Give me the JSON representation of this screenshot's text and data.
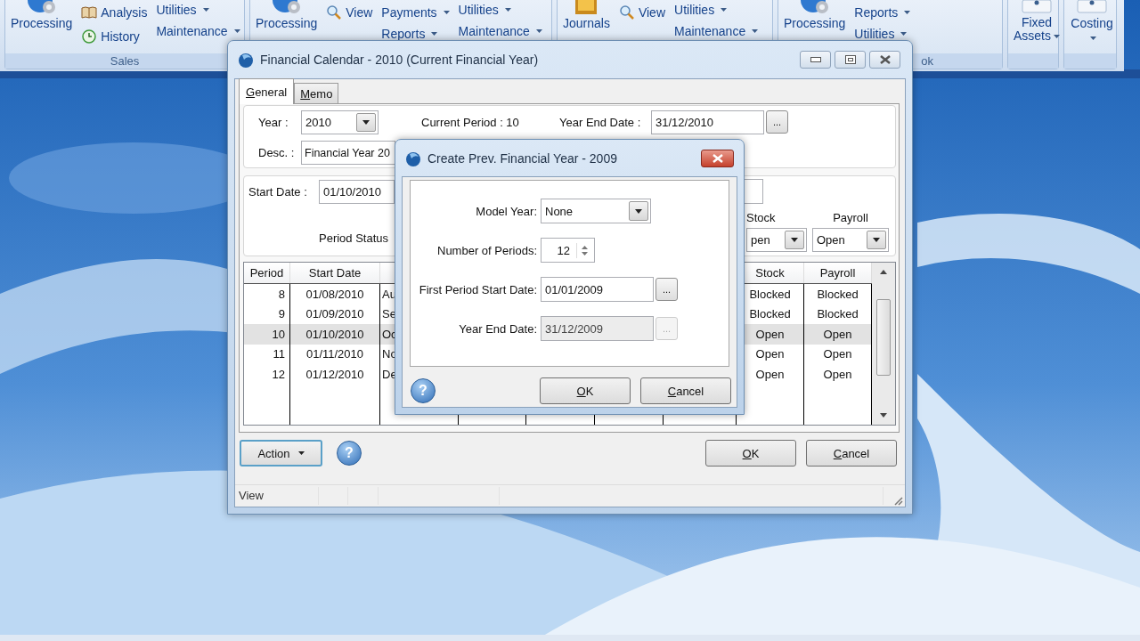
{
  "ribbon": {
    "groups": [
      {
        "label": "Sales",
        "items": [
          {
            "kind": "large",
            "label": "Processing",
            "dropdown": false
          },
          {
            "kind": "stack",
            "entries": [
              {
                "kind": "link",
                "label": "Analysis"
              },
              {
                "kind": "link",
                "label": "History"
              }
            ]
          },
          {
            "kind": "stack",
            "entries": [
              {
                "kind": "menu",
                "label": "Utilities"
              },
              {
                "kind": "menu",
                "label": "Maintenance"
              }
            ]
          }
        ]
      },
      {
        "items": [
          {
            "kind": "large",
            "label": "Processing",
            "dropdown": false
          },
          {
            "kind": "stack",
            "entries": [
              {
                "kind": "link",
                "label": "View"
              }
            ]
          },
          {
            "kind": "stack",
            "entries": [
              {
                "kind": "menu",
                "label": "Payments"
              },
              {
                "kind": "menu",
                "label": "Reports"
              }
            ]
          },
          {
            "kind": "stack",
            "entries": [
              {
                "kind": "menu",
                "label": "Utilities"
              },
              {
                "kind": "menu",
                "label": "Maintenance"
              }
            ]
          }
        ]
      },
      {
        "items": [
          {
            "kind": "large",
            "label": "Journals",
            "dropdown": false
          },
          {
            "kind": "stack",
            "entries": [
              {
                "kind": "link",
                "label": "View"
              }
            ]
          },
          {
            "kind": "stack",
            "entries": [
              {
                "kind": "menu",
                "label": "Utilities"
              },
              {
                "kind": "menu",
                "label": "Maintenance"
              }
            ]
          }
        ]
      },
      {
        "label": "ok",
        "items": [
          {
            "kind": "large",
            "label": "Processing",
            "dropdown": false
          },
          {
            "kind": "stack",
            "entries": [
              {
                "kind": "menu",
                "label": "Reports"
              },
              {
                "kind": "menu",
                "label": "Utilities"
              }
            ]
          }
        ]
      },
      {
        "items": [
          {
            "kind": "large",
            "label": "Fixed Assets",
            "dropdown": true
          }
        ]
      },
      {
        "items": [
          {
            "kind": "large",
            "label": "Costing",
            "dropdown": true
          }
        ]
      }
    ]
  },
  "main_window": {
    "title": "Financial Calendar - 2010 (Current Financial Year)",
    "tabs": [
      {
        "label": "General",
        "selected": true
      },
      {
        "label": "Memo",
        "selected": false
      }
    ],
    "year": {
      "label": "Year :",
      "value": "2010"
    },
    "current_period": "Current Period : 10",
    "year_end_date": {
      "label": "Year End Date :",
      "value": "31/12/2010",
      "button": "..."
    },
    "desc": {
      "label": "Desc. :",
      "value": "Financial Year 20"
    },
    "start_date": {
      "label": "Start Date :",
      "value": "01/10/2010"
    },
    "period_status": "Period Status",
    "module_status": [
      {
        "label": "Stock",
        "value": "pen"
      },
      {
        "label": "Payroll",
        "value": "Open"
      }
    ],
    "grid": {
      "columns": [
        "Period",
        "Start Date",
        "Stock",
        "Payroll"
      ],
      "rows": [
        {
          "period": "8",
          "start_date": "01/08/2010",
          "column_3": "Au",
          "stock": "Blocked",
          "payroll": "Blocked",
          "selected": false
        },
        {
          "period": "9",
          "start_date": "01/09/2010",
          "column_3": "Se",
          "stock": "Blocked",
          "payroll": "Blocked",
          "selected": false
        },
        {
          "period": "10",
          "start_date": "01/10/2010",
          "column_3": "Oc",
          "stock": "Open",
          "payroll": "Open",
          "selected": true
        },
        {
          "period": "11",
          "start_date": "01/11/2010",
          "column_3": "No",
          "stock": "Open",
          "payroll": "Open",
          "selected": false
        },
        {
          "period": "12",
          "start_date": "01/12/2010",
          "column_3": "De",
          "stock": "Open",
          "payroll": "Open",
          "selected": false
        }
      ]
    },
    "action_button": "Action",
    "help": "?",
    "ok": "OK",
    "cancel": "Cancel",
    "status_bar": "View"
  },
  "dialog": {
    "title": "Create Prev. Financial Year - 2009",
    "fields": [
      {
        "kind": "combo",
        "label": "Model Year:",
        "value": "None",
        "disabled": false
      },
      {
        "kind": "spinner",
        "label": "Number of Periods:",
        "value": "12",
        "disabled": false
      },
      {
        "kind": "date",
        "label": "First Period Start Date:",
        "value": "01/01/2009",
        "button": "...",
        "disabled": false
      },
      {
        "kind": "date",
        "label": "Year End Date:",
        "value": "31/12/2009",
        "button": "...",
        "disabled": true
      }
    ],
    "help": "?",
    "ok": "OK",
    "cancel": "Cancel"
  }
}
